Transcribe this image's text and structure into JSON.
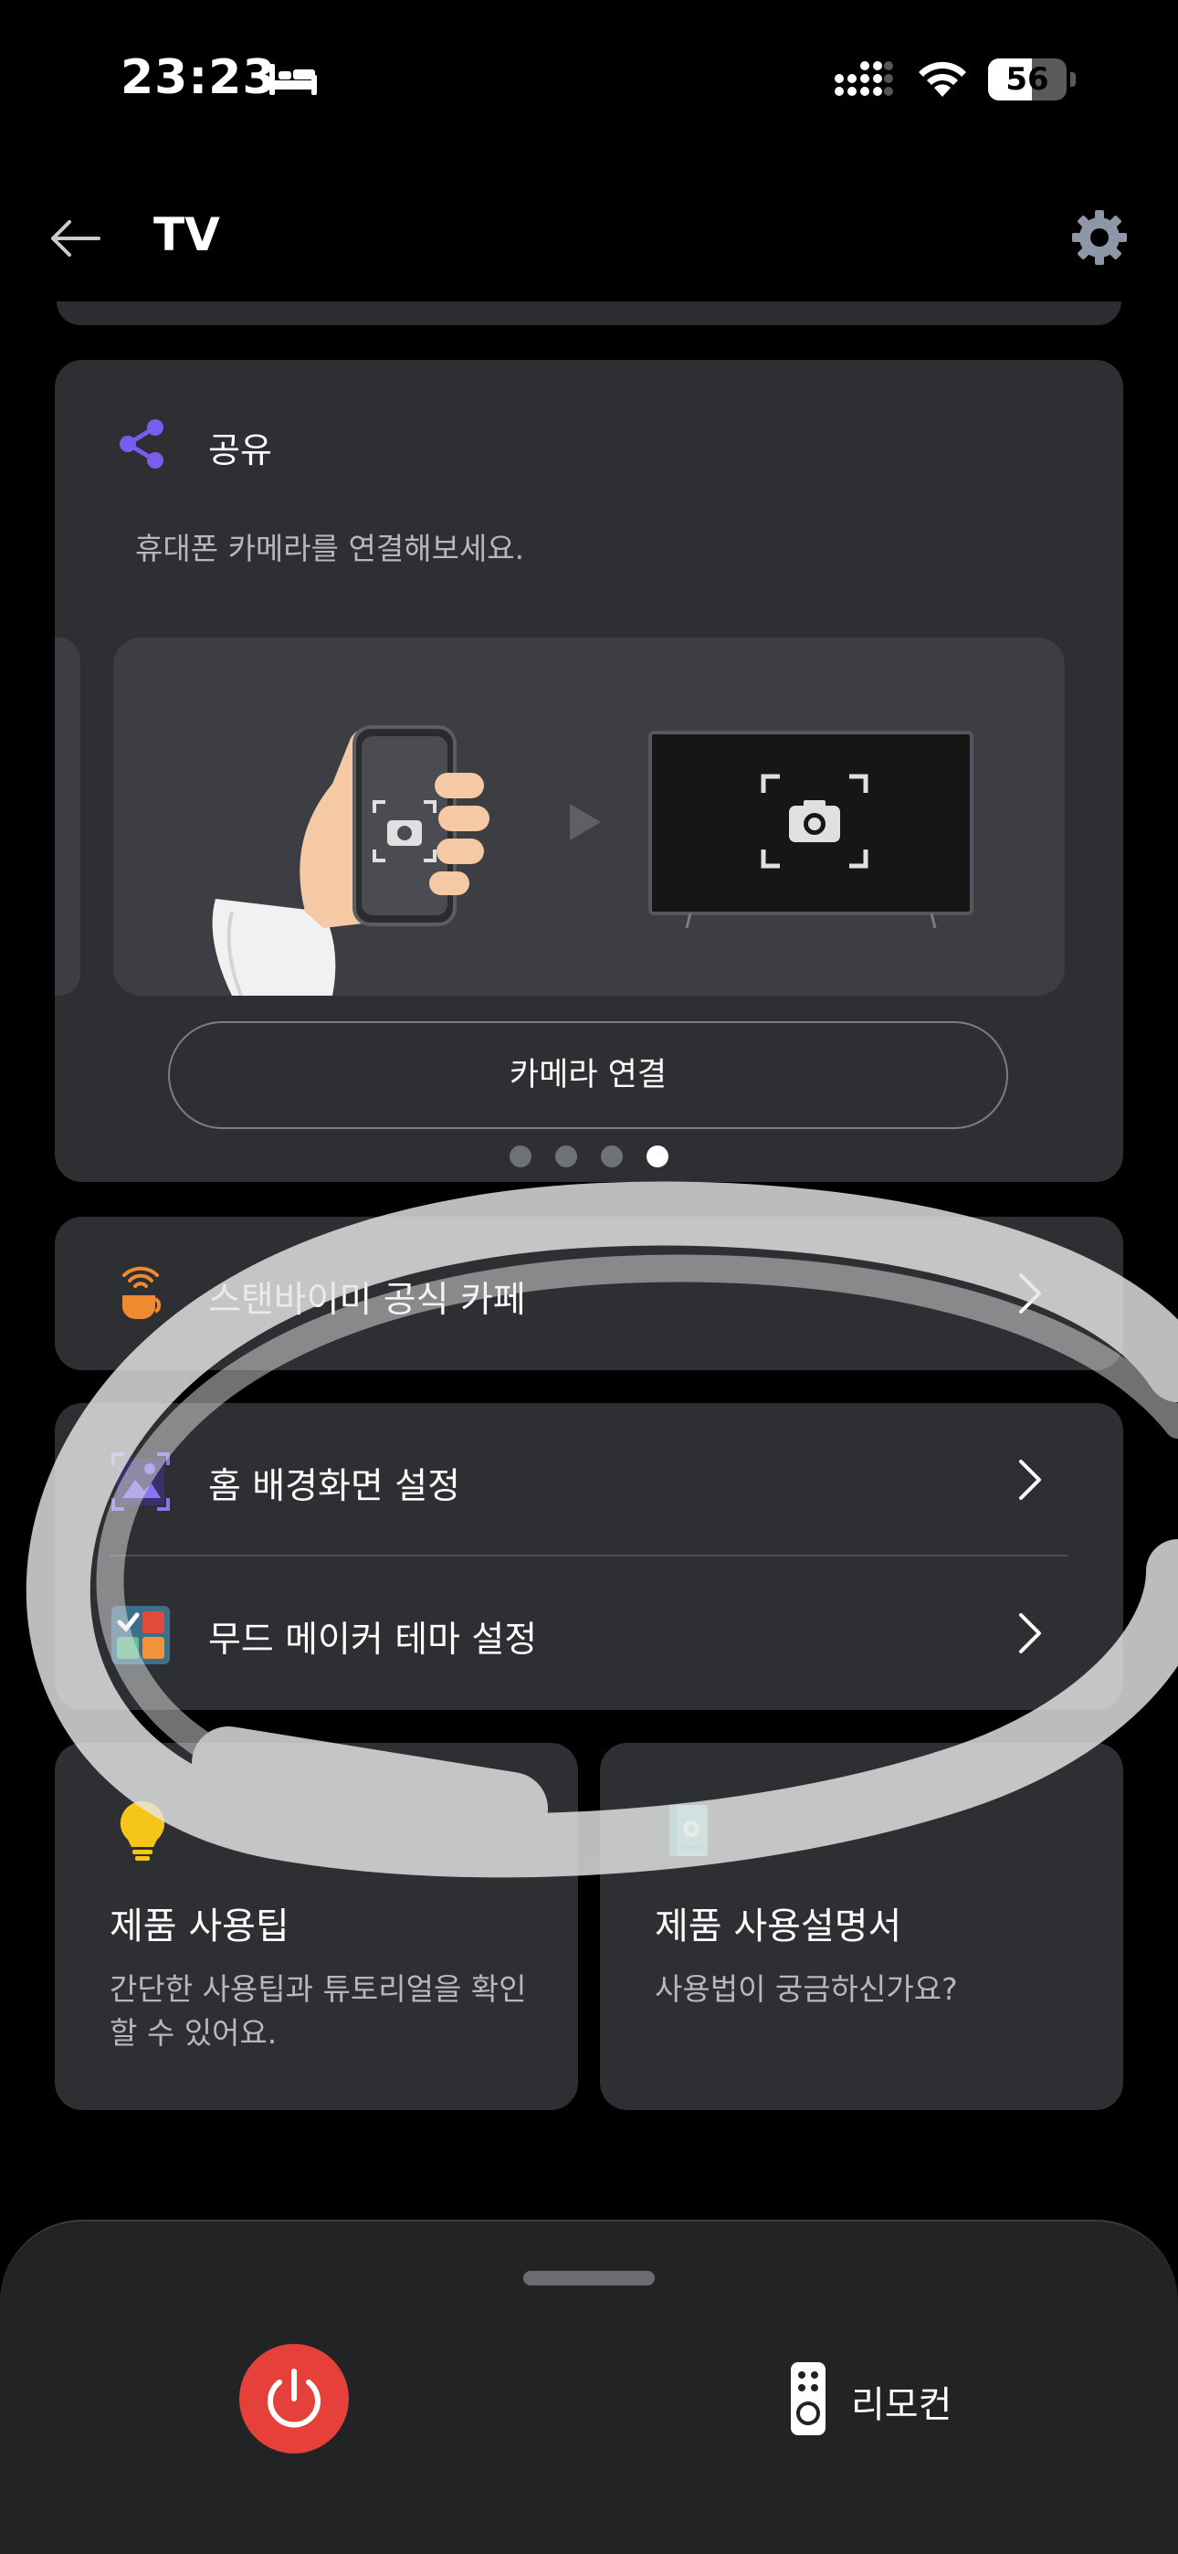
{
  "status_bar": {
    "time": "23:23",
    "battery": "56",
    "battery_percent": 56
  },
  "header": {
    "title": "TV"
  },
  "share_card": {
    "title": "공유",
    "description": "휴대폰 카메라를 연결해보세요.",
    "button_label": "카메라 연결",
    "page_count": 4,
    "active_page": 4
  },
  "list": {
    "cafe_label": "스탠바이미 공식 카페",
    "wallpaper_label": "홈 배경화면 설정",
    "mood_label": "무드 메이커 테마 설정"
  },
  "tiles": {
    "tips_title": "제품 사용팁",
    "tips_desc": "간단한 사용팁과 튜토리얼을 확인할 수 있어요.",
    "manual_title": "제품 사용설명서",
    "manual_desc": "사용법이 궁금하신가요?"
  },
  "bottom_bar": {
    "remote_label": "리모컨"
  },
  "colors": {
    "background": "#000000",
    "card": "#2d2f33",
    "accent_purple": "#7b5cf0",
    "power_red": "#e5403a",
    "cafe_orange": "#f08a2e",
    "tips_yellow": "#f5c518",
    "manual_teal": "#3ab0a4"
  },
  "icons": [
    "bed-icon",
    "signal-icon",
    "wifi-icon",
    "back-arrow-icon",
    "gear-icon",
    "share-icon",
    "camera-icon",
    "play-icon",
    "cafe-cup-icon",
    "wallpaper-icon",
    "mood-theme-icon",
    "chevron-right-icon",
    "lightbulb-icon",
    "manual-book-icon",
    "power-icon",
    "remote-icon"
  ]
}
